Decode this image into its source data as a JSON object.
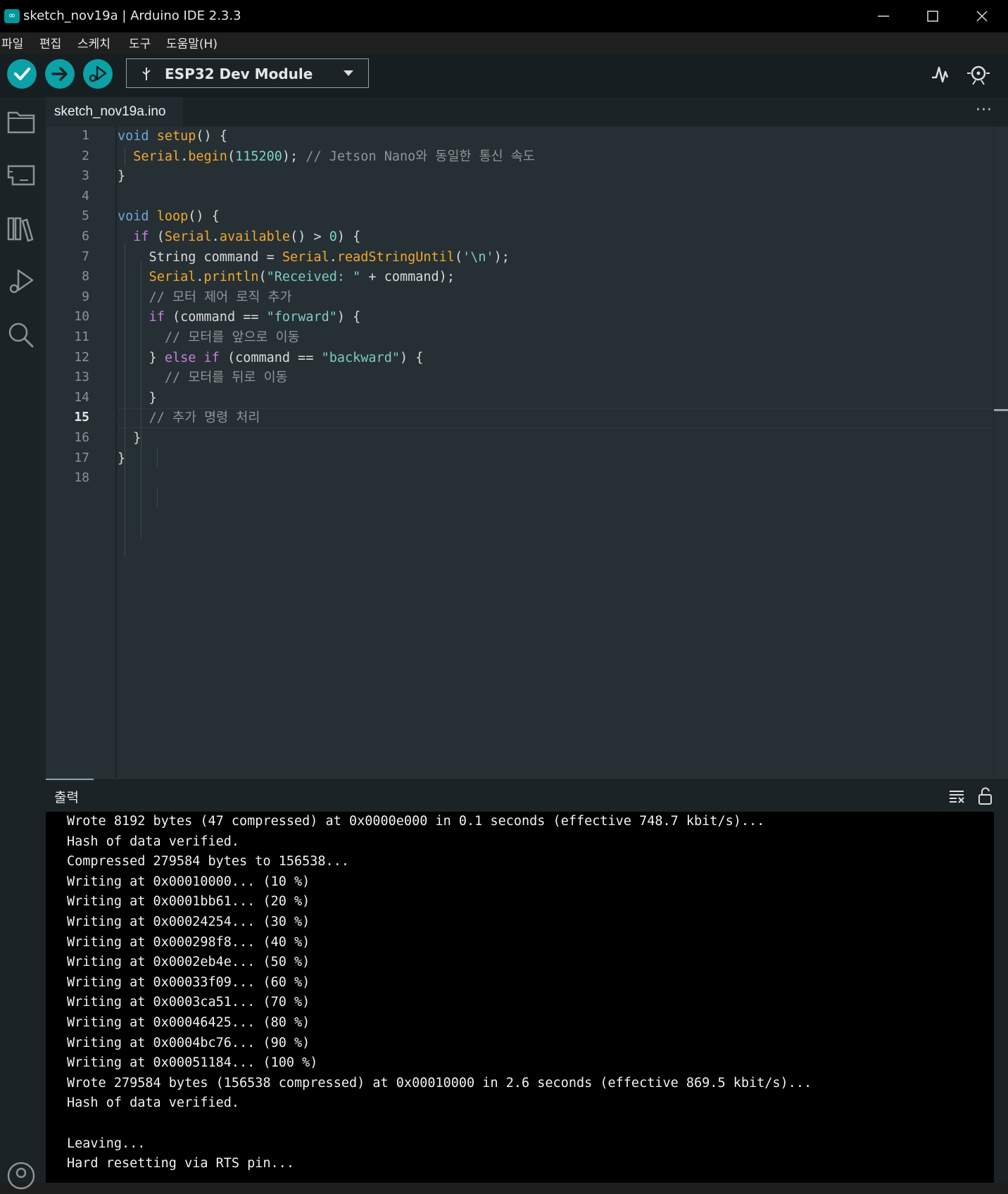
{
  "window": {
    "title": "sketch_nov19a | Arduino IDE 2.3.3",
    "logo": "∞"
  },
  "menu": [
    "파일",
    "편집",
    "스케치",
    "도구",
    "도움말(H)"
  ],
  "toolbar": {
    "board": "ESP32 Dev Module",
    "verify_icon": "check-icon",
    "upload_icon": "arrow-right-icon",
    "debug_icon": "debug-icon"
  },
  "tab": {
    "filename": "sketch_nov19a.ino",
    "more": "···"
  },
  "editor": {
    "current_line": 15,
    "line_numbers": [
      "1",
      "2",
      "3",
      "4",
      "5",
      "6",
      "7",
      "8",
      "9",
      "10",
      "11",
      "12",
      "13",
      "14",
      "15",
      "16",
      "17",
      "18"
    ],
    "lines": [
      [
        [
          "ty",
          "void "
        ],
        [
          "fn",
          "setup"
        ],
        [
          "",
          "() {"
        ]
      ],
      [
        [
          "",
          "  "
        ],
        [
          "fn",
          "Serial"
        ],
        [
          "",
          "."
        ],
        [
          "fn",
          "begin"
        ],
        [
          "",
          "("
        ],
        [
          "num",
          "115200"
        ],
        [
          "",
          "); "
        ],
        [
          "cm",
          "// Jetson Nano와 동일한 통신 속도"
        ]
      ],
      [
        [
          "",
          "}"
        ]
      ],
      [],
      [
        [
          "ty",
          "void "
        ],
        [
          "fn",
          "loop"
        ],
        [
          "",
          "() {"
        ]
      ],
      [
        [
          "",
          "  "
        ],
        [
          "kw",
          "if "
        ],
        [
          "",
          "("
        ],
        [
          "fn",
          "Serial"
        ],
        [
          "",
          "."
        ],
        [
          "fn",
          "available"
        ],
        [
          "",
          "() > "
        ],
        [
          "num",
          "0"
        ],
        [
          "",
          ") {"
        ]
      ],
      [
        [
          "",
          "    String command = "
        ],
        [
          "fn",
          "Serial"
        ],
        [
          "",
          "."
        ],
        [
          "fn",
          "readStringUntil"
        ],
        [
          "",
          "("
        ],
        [
          "str",
          "'\\n'"
        ],
        [
          "",
          ");"
        ]
      ],
      [
        [
          "",
          "    "
        ],
        [
          "fn",
          "Serial"
        ],
        [
          "",
          "."
        ],
        [
          "fn",
          "println"
        ],
        [
          "",
          "("
        ],
        [
          "str",
          "\"Received: \""
        ],
        [
          "",
          " + command);"
        ]
      ],
      [
        [
          "",
          "    "
        ],
        [
          "cm",
          "// 모터 제어 로직 추가"
        ]
      ],
      [
        [
          "",
          "    "
        ],
        [
          "kw",
          "if "
        ],
        [
          "",
          "(command == "
        ],
        [
          "str",
          "\"forward\""
        ],
        [
          "",
          ") {"
        ]
      ],
      [
        [
          "",
          "      "
        ],
        [
          "cm",
          "// 모터를 앞으로 이동"
        ]
      ],
      [
        [
          "",
          "    } "
        ],
        [
          "kw",
          "else if "
        ],
        [
          "",
          "(command == "
        ],
        [
          "str",
          "\"backward\""
        ],
        [
          "",
          ") {"
        ]
      ],
      [
        [
          "",
          "      "
        ],
        [
          "cm",
          "// 모터를 뒤로 이동"
        ]
      ],
      [
        [
          "",
          "    }"
        ]
      ],
      [
        [
          "",
          "    "
        ],
        [
          "cm",
          "// 추가 명령 처리"
        ]
      ],
      [
        [
          "",
          "  }"
        ]
      ],
      [
        [
          "",
          "}"
        ]
      ],
      []
    ]
  },
  "output": {
    "title": "출력",
    "lines": [
      "Wrote 8192 bytes (47 compressed) at 0x0000e000 in 0.1 seconds (effective 748.7 kbit/s)...",
      "Hash of data verified.",
      "Compressed 279584 bytes to 156538...",
      "Writing at 0x00010000... (10 %)",
      "Writing at 0x0001bb61... (20 %)",
      "Writing at 0x00024254... (30 %)",
      "Writing at 0x000298f8... (40 %)",
      "Writing at 0x0002eb4e... (50 %)",
      "Writing at 0x00033f09... (60 %)",
      "Writing at 0x0003ca51... (70 %)",
      "Writing at 0x00046425... (80 %)",
      "Writing at 0x0004bc76... (90 %)",
      "Writing at 0x00051184... (100 %)",
      "Wrote 279584 bytes (156538 compressed) at 0x00010000 in 2.6 seconds (effective 869.5 kbit/s)...",
      "Hash of data verified.",
      "",
      "Leaving...",
      "Hard resetting via RTS pin..."
    ]
  },
  "colors": {
    "accent": "#0ca1a6",
    "editor_bg": "#263034",
    "output_bg": "#000000"
  }
}
